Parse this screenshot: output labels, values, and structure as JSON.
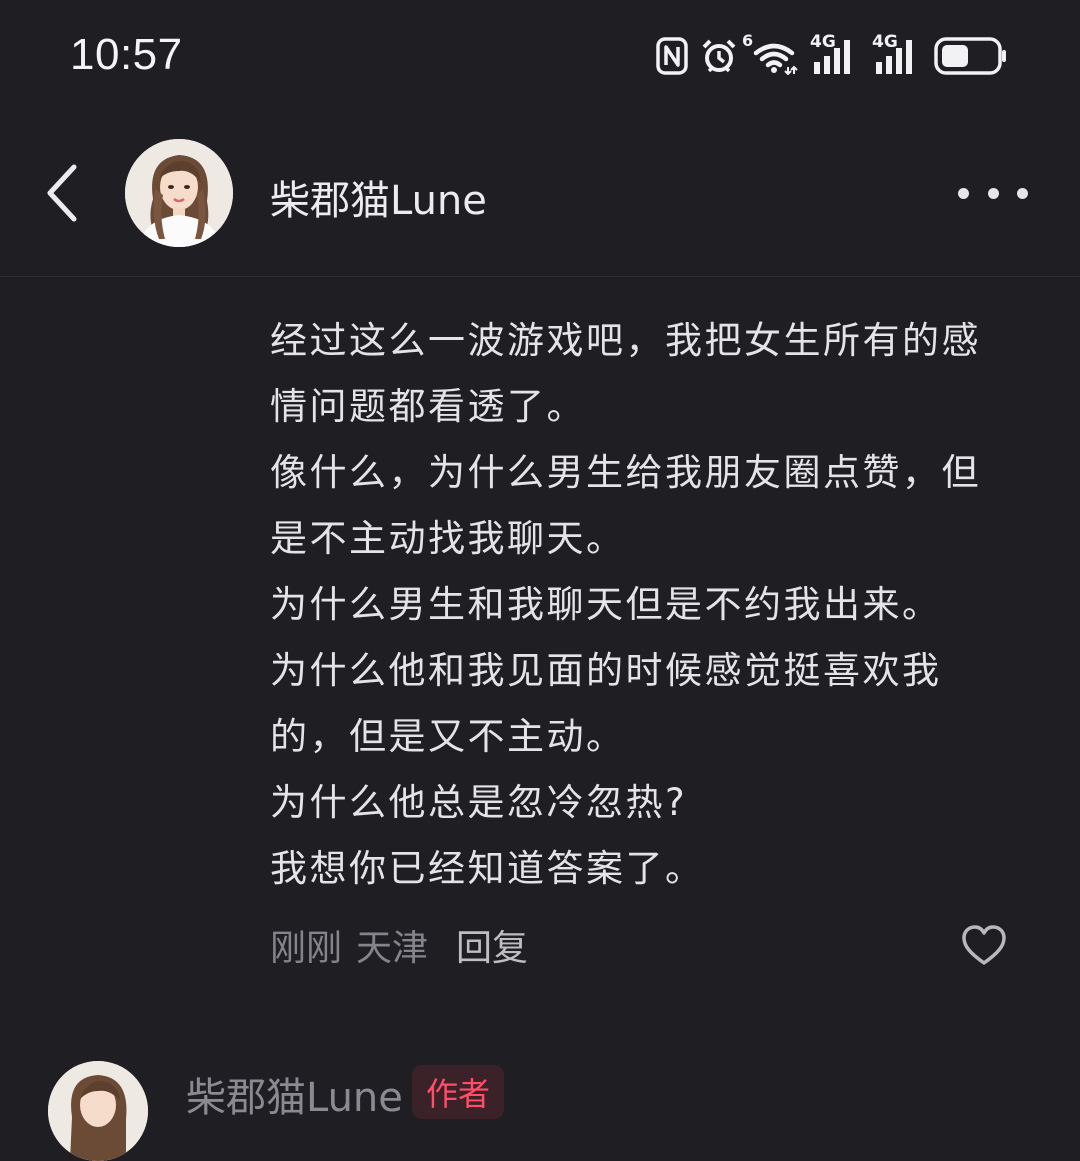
{
  "status_bar": {
    "time": "10:57",
    "icons": [
      "nfc-icon",
      "alarm-icon",
      "wifi-6-icon",
      "signal-4g-icon",
      "signal-4g-icon",
      "battery-icon"
    ],
    "network_labels": [
      "6",
      "4G",
      "4G"
    ]
  },
  "header": {
    "username": "柴郡猫Lune"
  },
  "comment": {
    "lines": [
      "经过这么一波游戏吧，我把女生所有的感",
      "情问题都看透了。",
      "像什么，为什么男生给我朋友圈点赞，但",
      "是不主动找我聊天。",
      "为什么男生和我聊天但是不约我出来。",
      "为什么他和我见面的时候感觉挺喜欢我",
      "的，但是又不主动。",
      "为什么他总是忽冷忽热?",
      "我想你已经知道答案了。"
    ],
    "time": "刚刚",
    "location": "天津",
    "reply_label": "回复"
  },
  "next_comment": {
    "username": "柴郡猫Lune",
    "badge": "作者"
  },
  "colors": {
    "background": "#1e1e23",
    "text_primary": "#e4e4e7",
    "text_secondary": "#84848a",
    "badge_red": "#ff4d6a"
  }
}
